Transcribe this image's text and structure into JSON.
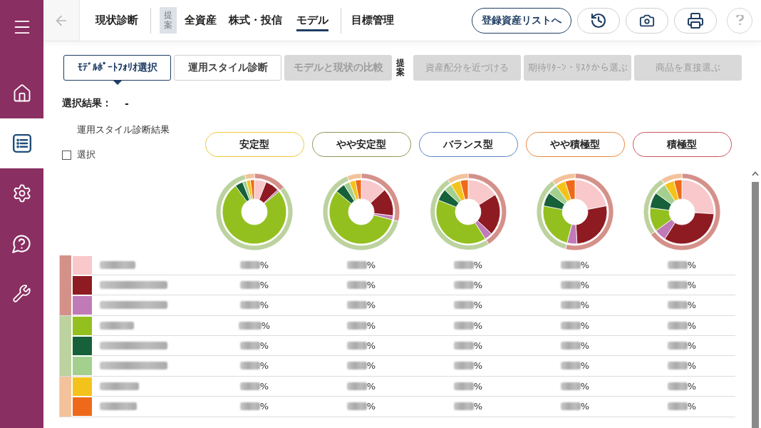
{
  "sidebar": {
    "items": [
      {
        "kind": "home",
        "selected": false
      },
      {
        "kind": "list",
        "selected": true
      },
      {
        "kind": "settings",
        "selected": false
      },
      {
        "kind": "help",
        "selected": false
      },
      {
        "kind": "tools",
        "selected": false
      }
    ]
  },
  "nav": {
    "back_button": {
      "disabled": true
    },
    "main_tab": {
      "label": "現状診断",
      "selected": false
    },
    "proposal_tag": "提案",
    "proposal_tabs": [
      {
        "label": "全資産",
        "selected": false
      },
      {
        "label": "株式・投信",
        "selected": false
      },
      {
        "label": "モデル",
        "selected": true
      }
    ],
    "goal_tab": {
      "label": "目標管理",
      "selected": false
    },
    "asset_list_button": "登録資産リストへ",
    "help_button": {
      "disabled": true
    }
  },
  "steps": {
    "tabs": [
      {
        "label": "ﾓﾃﾞﾙﾎﾟｰﾄﾌｫﾘｵ選択",
        "selected": true,
        "disabled": false
      },
      {
        "label": "運用スタイル診断",
        "selected": false,
        "disabled": false
      },
      {
        "label": "モデルと現状の比較",
        "selected": false,
        "disabled": true
      }
    ],
    "proposal_tag": "提案",
    "proposal_tabs": [
      {
        "label": "資産配分を近づける",
        "selected": false,
        "disabled": true
      },
      {
        "label": "期待ﾘﾀｰﾝ・ﾘｽｸから選ぶ",
        "selected": false,
        "disabled": true
      },
      {
        "label": "商品を直接選ぶ",
        "selected": false,
        "disabled": true
      }
    ]
  },
  "selection_result": {
    "label": "選択結果：",
    "value": "-"
  },
  "style_diagnosis": {
    "label": "運用スタイル診断結果",
    "checkbox": {
      "label": "選択",
      "checked": false
    }
  },
  "styles": [
    {
      "label": "安定型",
      "color": "#f0c83a"
    },
    {
      "label": "やや安定型",
      "color": "#8a9a5b"
    },
    {
      "label": "バランス型",
      "color": "#5b85c6"
    },
    {
      "label": "やや積極型",
      "color": "#e8873a"
    },
    {
      "label": "積極型",
      "color": "#c9535a"
    }
  ],
  "allocation": {
    "groups": [
      {
        "color": "#d4918a",
        "rows": [
          {
            "color": "#f8c8cb",
            "values": [
              "%",
              "%",
              "%",
              "%",
              "%"
            ]
          },
          {
            "color": "#8e1b22",
            "values": [
              "%",
              "%",
              "%",
              "%",
              "%"
            ]
          },
          {
            "color": "#c07ab8",
            "values": [
              "%",
              "%",
              "%",
              "%",
              "%"
            ]
          }
        ]
      },
      {
        "color": "#bcd29f",
        "rows": [
          {
            "color": "#93c01f",
            "values": [
              "%",
              "%",
              "%",
              "%",
              "%"
            ]
          },
          {
            "color": "#17613a",
            "values": [
              "%",
              "%",
              "%",
              "%",
              "%"
            ]
          },
          {
            "color": "#a3d08e",
            "values": [
              "%",
              "%",
              "%",
              "%",
              "%"
            ]
          }
        ]
      },
      {
        "color": "#f3c29b",
        "rows": [
          {
            "color": "#f4c31b",
            "values": [
              "%",
              "%",
              "%",
              "%",
              "%"
            ]
          },
          {
            "color": "#ee6a1a",
            "values": [
              "%",
              "%",
              "%",
              "%",
              "%"
            ]
          }
        ]
      }
    ]
  }
}
